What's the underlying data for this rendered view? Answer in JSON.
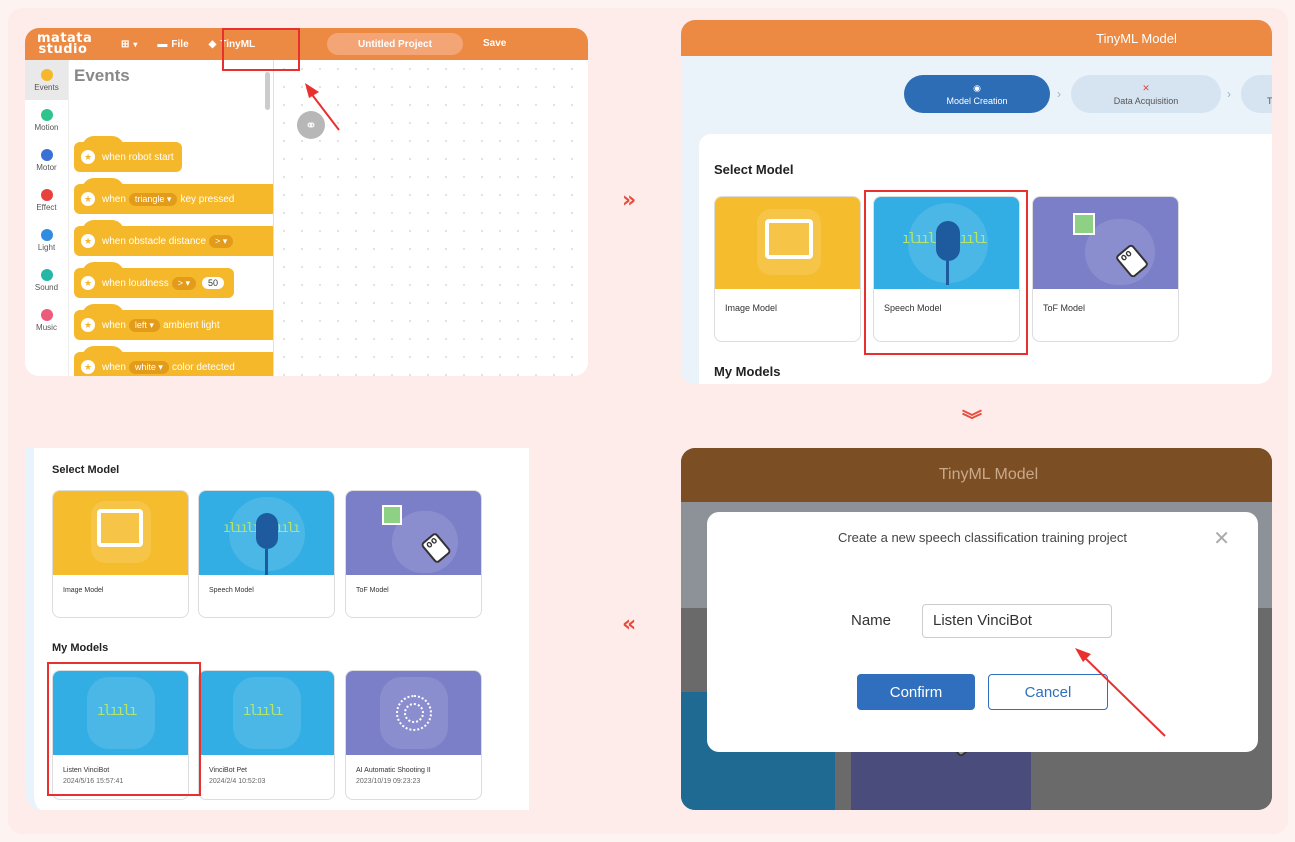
{
  "studio": {
    "logo": "matata studio",
    "menu_file": "File",
    "menu_tinyml": "TinyML",
    "project_name": "Untitled Project",
    "save": "Save",
    "categories": [
      {
        "label": "Events",
        "color": "#f5b82a"
      },
      {
        "label": "Motion",
        "color": "#2fc38e"
      },
      {
        "label": "Motor",
        "color": "#3a6fd8"
      },
      {
        "label": "Effect",
        "color": "#e8403c"
      },
      {
        "label": "Light",
        "color": "#2f8ce0"
      },
      {
        "label": "Sound",
        "color": "#24b7a8"
      },
      {
        "label": "Music",
        "color": "#ec5b7a"
      }
    ],
    "palette_title": "Events",
    "blocks": {
      "b1": "when robot start",
      "b2_pre": "when",
      "b2_opt": "triangle ▾",
      "b2_post": "key pressed",
      "b3_pre": "when obstacle distance",
      "b3_opt": "> ▾",
      "b4_pre": "when loudness",
      "b4_opt": "> ▾",
      "b4_val": "50",
      "b5_pre": "when",
      "b5_opt": "left ▾",
      "b5_post": "ambient light",
      "b6_pre": "when",
      "b6_opt": "white ▾",
      "b6_post": "color detected"
    }
  },
  "tinyml": {
    "header": "TinyML Model",
    "steps": [
      "Model Creation",
      "Data Acquisition",
      "Tr"
    ],
    "select_model": "Select Model",
    "models": [
      "Image Model",
      "Speech Model",
      "ToF Model"
    ],
    "my_models": "My Models"
  },
  "models_list": {
    "select_model": "Select Model",
    "models": [
      "Image Model",
      "Speech Model",
      "ToF Model"
    ],
    "my_models": "My Models",
    "saved": [
      {
        "name": "Listen VinciBot",
        "date": "2024/5/16 15:57:41"
      },
      {
        "name": "VinciBot Pet",
        "date": "2024/2/4 10:52:03"
      },
      {
        "name": "AI Automatic Shooting II",
        "date": "2023/10/19 09:23:23"
      }
    ]
  },
  "dialog": {
    "header": "TinyML Model",
    "title": "Create a new speech classification training project",
    "name_label": "Name",
    "name_value": "Listen VinciBot",
    "confirm": "Confirm",
    "cancel": "Cancel"
  },
  "flow": {
    "right": "»",
    "down": "︾",
    "left": "«"
  }
}
